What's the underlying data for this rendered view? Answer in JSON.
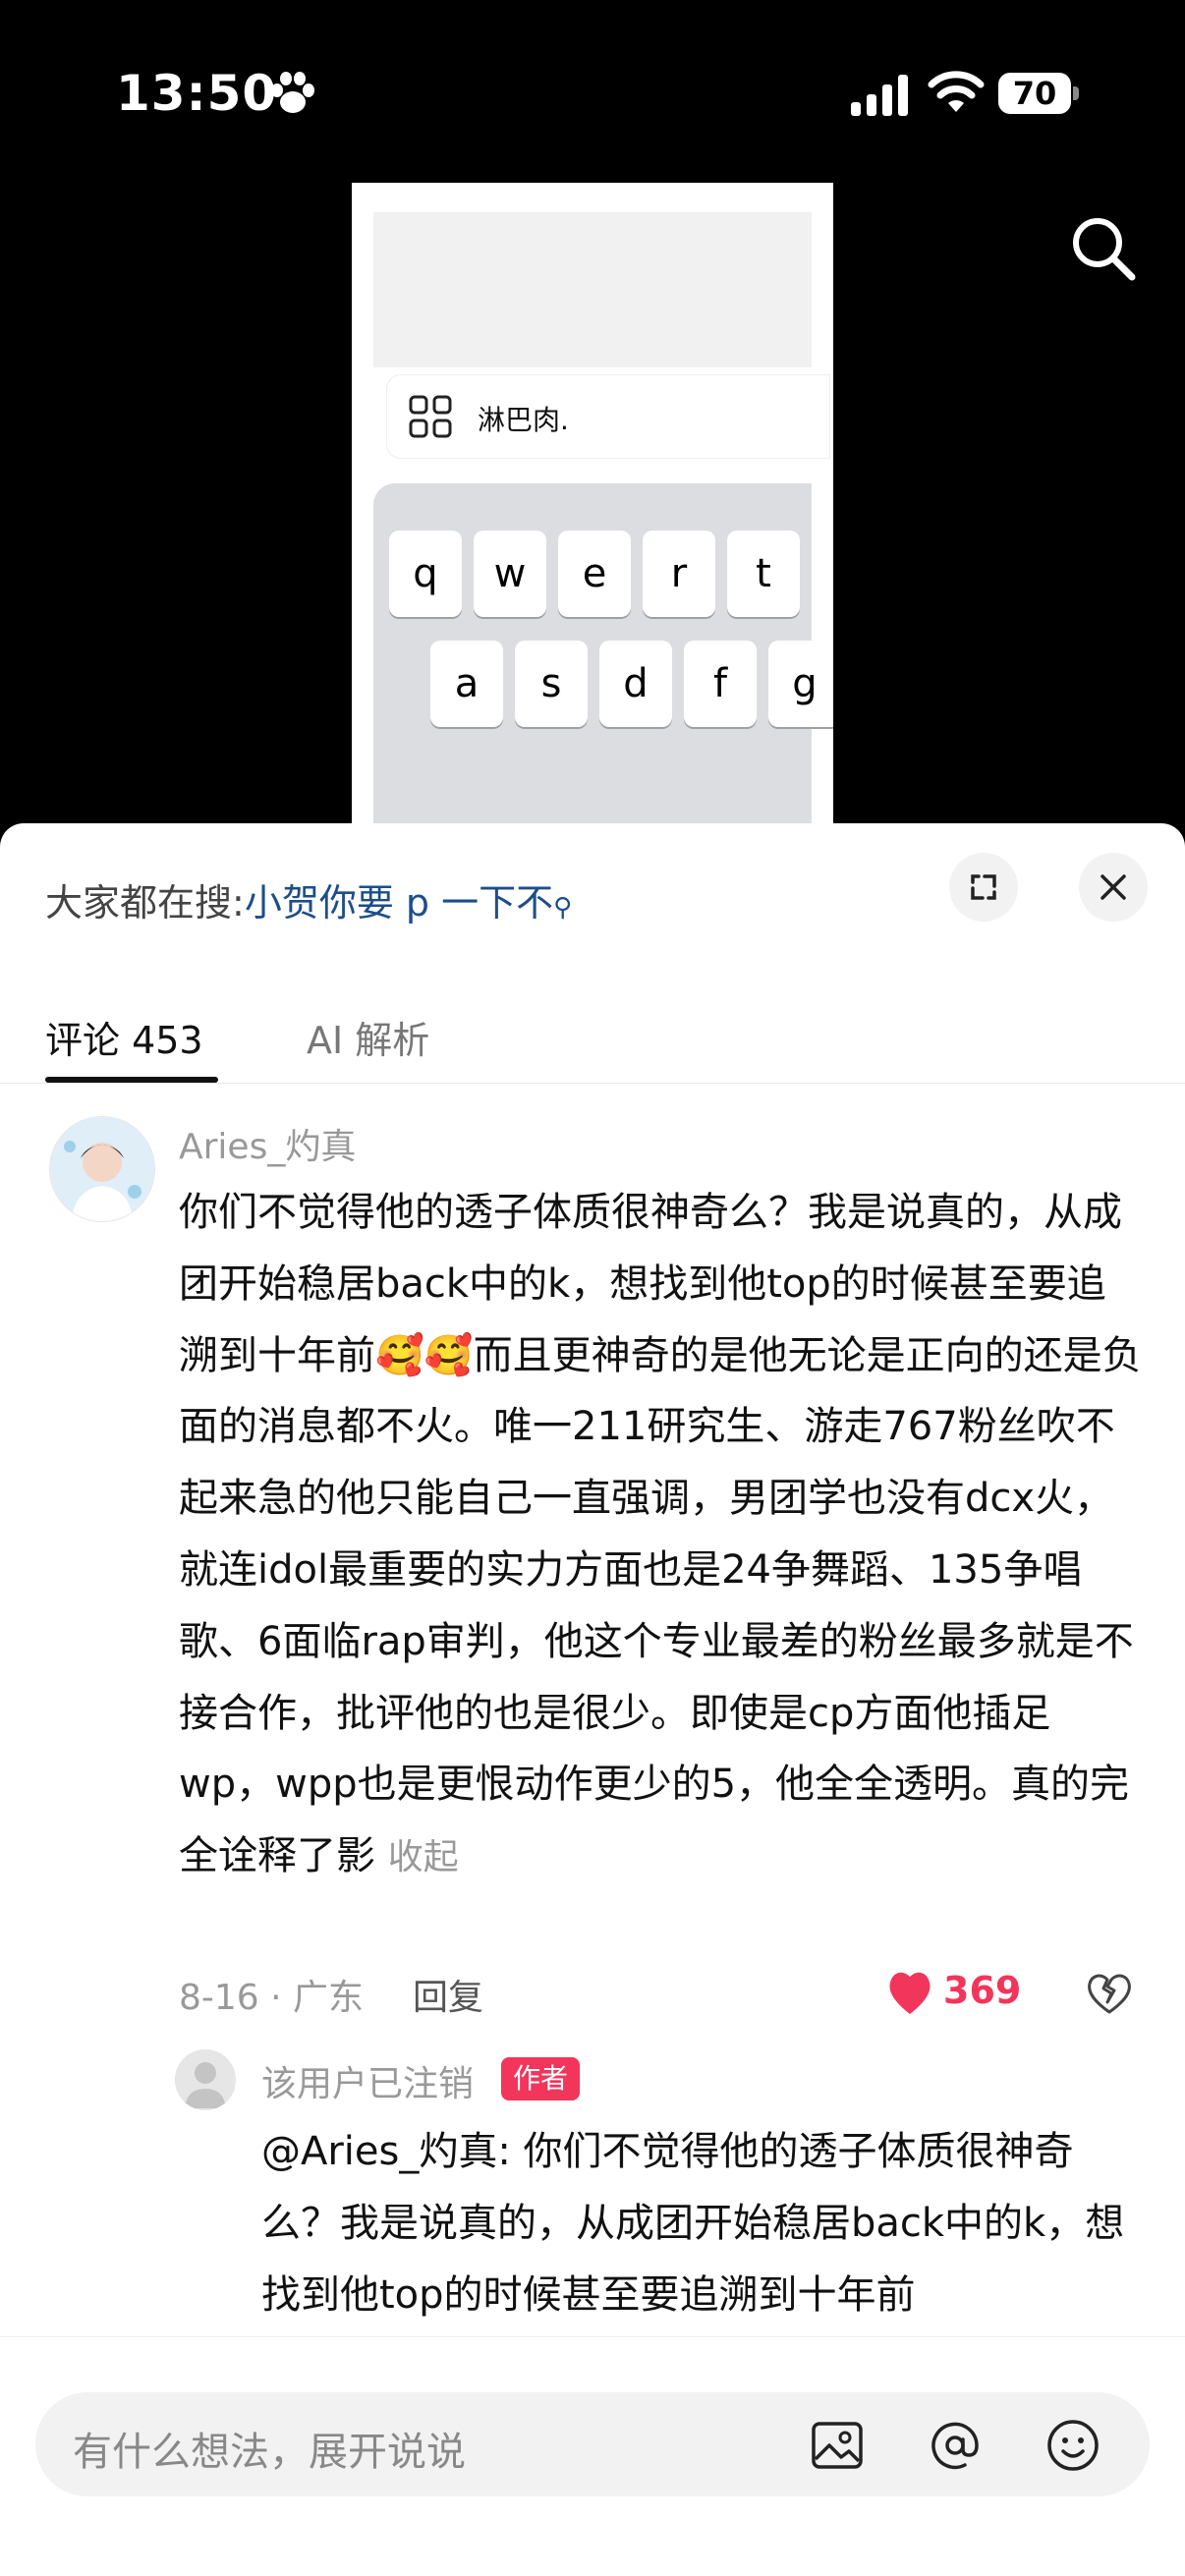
{
  "status_bar": {
    "time": "13:50",
    "battery": "70"
  },
  "video": {
    "suggestion": "淋巴肉.",
    "keys_row1": [
      "q",
      "w",
      "e",
      "r",
      "t"
    ],
    "keys_row2": [
      "a",
      "s",
      "d",
      "f",
      "g"
    ]
  },
  "sheet": {
    "search_prefix": "大家都在搜:",
    "search_keyword": "小贺你要 p 一下不",
    "tabs": [
      {
        "label": "评论 453"
      },
      {
        "label": "AI 解析"
      }
    ]
  },
  "comment": {
    "username": "Aries_灼真",
    "text": "你们不觉得他的透子体质很神奇么？我是说真的，从成团开始稳居back中的k，想找到他top的时候甚至要追溯到十年前🥰🥰而且更神奇的是他无论是正向的还是负面的消息都不火。唯一211研究生、游走767粉丝吹不起来急的他只能自己一直强调，男团学也没有dcx火，就连idol最重要的实力方面也是24争舞蹈、135争唱歌、6面临rap审判，他这个专业最差的粉丝最多就是不接合作，批评他的也是很少。即使是cp方面他插足wp，wpp也是更恨动作更少的5，他全全透明。真的完全诠释了影 ",
    "collapse_label": "收起",
    "meta": "8-16 · 广东",
    "reply_label": "回复",
    "like_count": "369"
  },
  "reply": {
    "username": "该用户已注销",
    "badge": "作者",
    "text": "@Aries_灼真: 你们不觉得他的透子体质很神奇么？我是说真的，从成团开始稳居back中的k，想找到他top的时候甚至要追溯到十年前"
  },
  "input": {
    "placeholder": "有什么想法，展开说说"
  },
  "colors": {
    "accent": "#f2355b",
    "link": "#1d4e89"
  }
}
